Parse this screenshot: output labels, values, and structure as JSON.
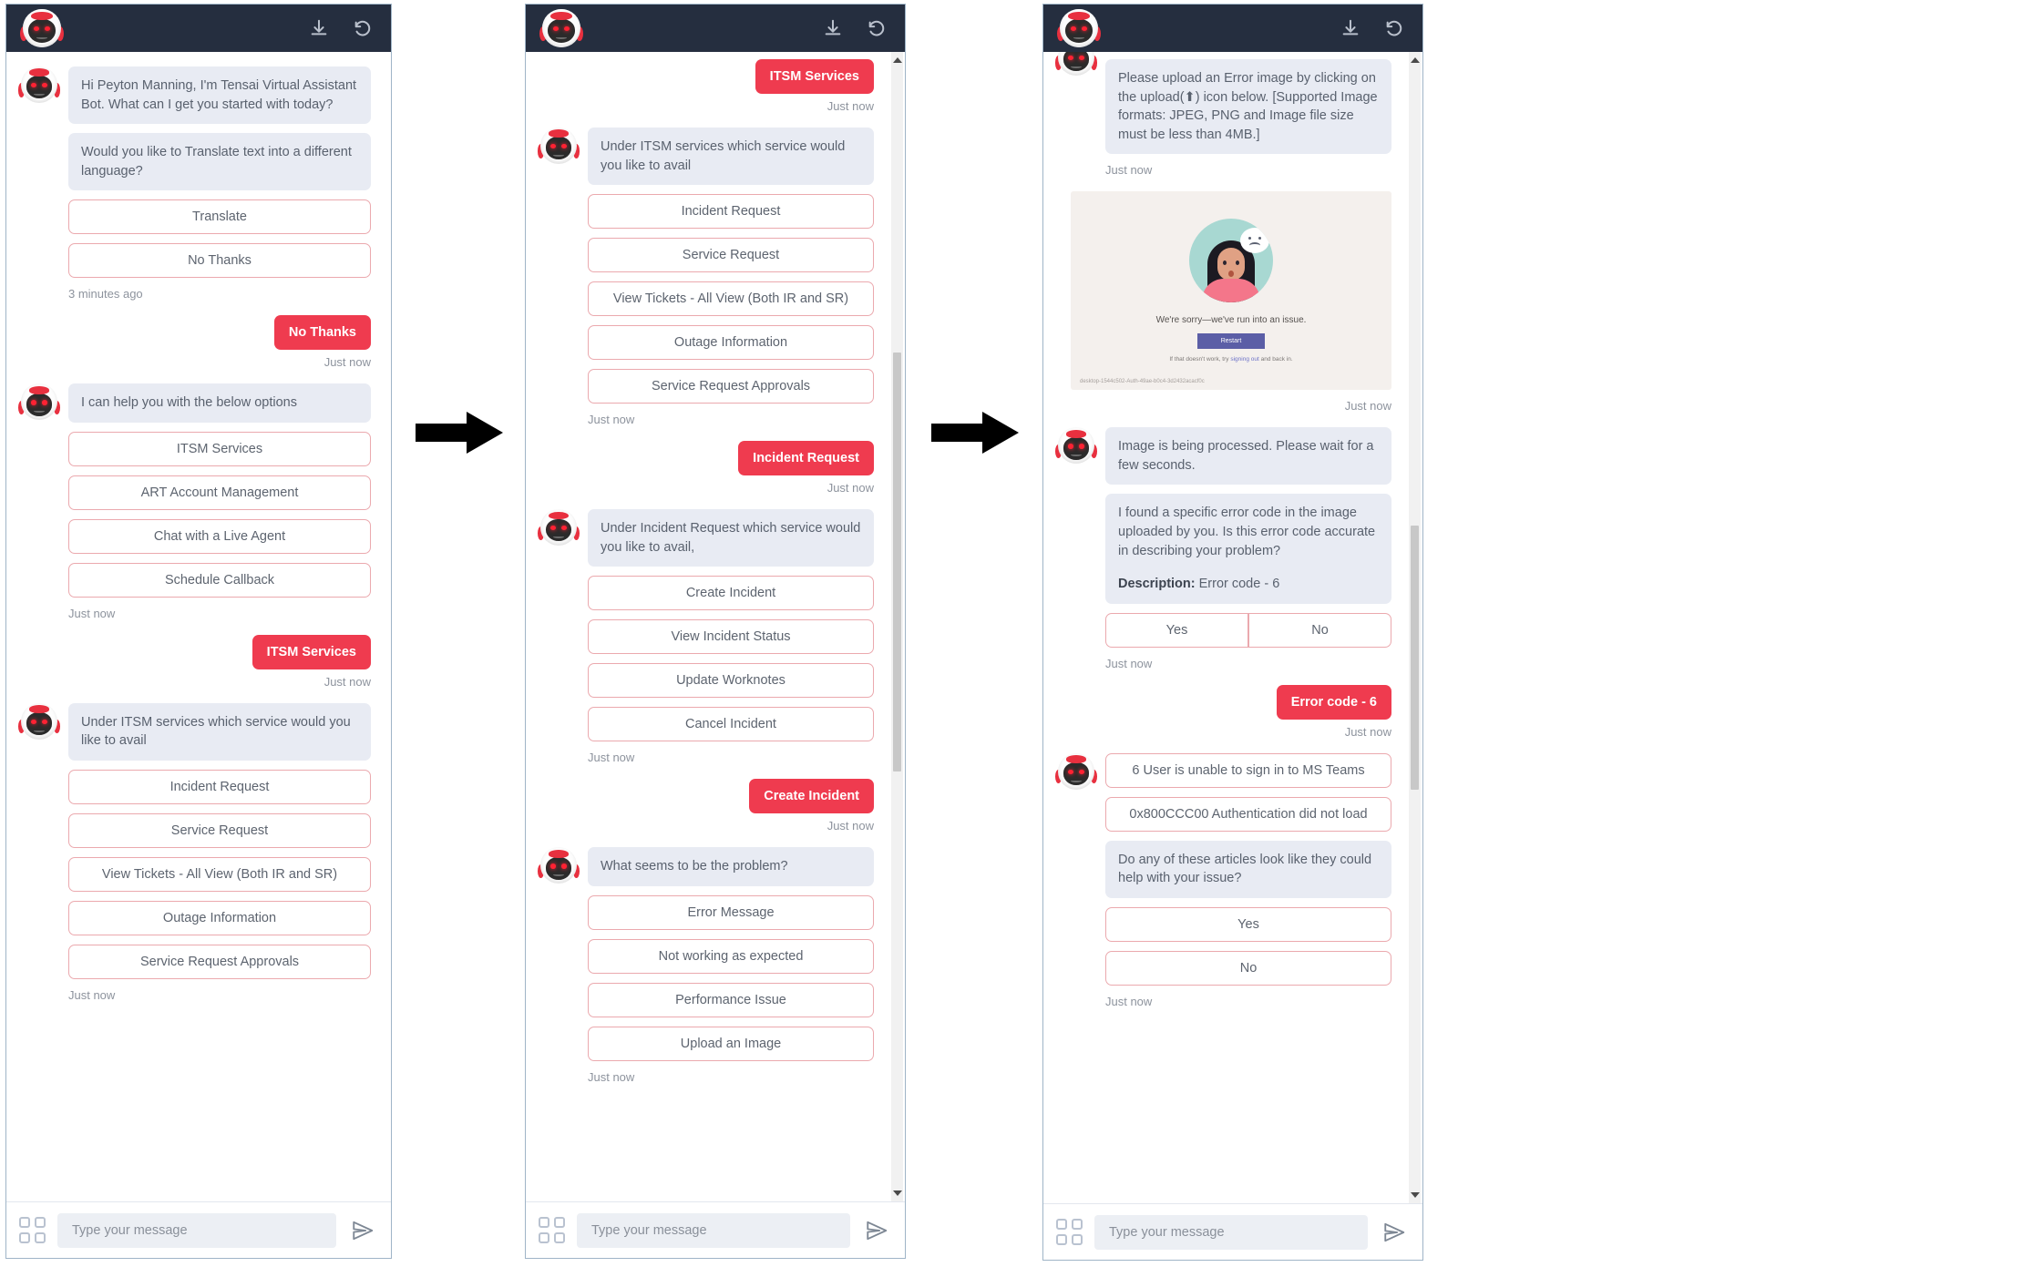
{
  "header": {
    "download_icon": "download-icon",
    "reset_icon": "reset-icon",
    "bot_icon": "bot-avatar-icon"
  },
  "input_bar": {
    "apps_icon": "grid-apps-icon",
    "placeholder": "Type your message",
    "value": "",
    "send_icon": "send-icon"
  },
  "colors": {
    "header_bg": "#252e3f",
    "user_bubble": "#ef3b4f",
    "bot_bubble": "#e8ebf3",
    "option_border": "#eba9ae",
    "panel_border": "#9fb4c7"
  },
  "panels": [
    {
      "id": "panel-1",
      "messages": [
        {
          "type": "bot_bubble",
          "text": "Hi Peyton Manning, I'm Tensai Virtual Assistant Bot. What can I get you started with today?"
        },
        {
          "type": "bot_bubble",
          "text": "Would you like to Translate text into a different language?"
        },
        {
          "type": "option",
          "text": "Translate"
        },
        {
          "type": "option",
          "text": "No Thanks"
        },
        {
          "type": "stamp",
          "text": "3 minutes ago"
        },
        {
          "type": "user_bubble",
          "text": "No Thanks"
        },
        {
          "type": "stamp_right",
          "text": "Just now"
        },
        {
          "type": "bot_bubble",
          "text": "I can help you with the below options"
        },
        {
          "type": "option",
          "text": "ITSM Services"
        },
        {
          "type": "option",
          "text": "ART Account Management"
        },
        {
          "type": "option",
          "text": "Chat with a Live Agent"
        },
        {
          "type": "option",
          "text": "Schedule Callback"
        },
        {
          "type": "stamp",
          "text": "Just now"
        },
        {
          "type": "user_bubble",
          "text": "ITSM Services"
        },
        {
          "type": "stamp_right",
          "text": "Just now"
        },
        {
          "type": "bot_bubble",
          "text": "Under ITSM services which service would you like to avail"
        },
        {
          "type": "option",
          "text": "Incident Request"
        },
        {
          "type": "option",
          "text": "Service Request"
        },
        {
          "type": "option",
          "text": "View Tickets - All View (Both IR and SR)"
        },
        {
          "type": "option",
          "text": "Outage Information"
        },
        {
          "type": "option",
          "text": "Service Request Approvals"
        },
        {
          "type": "stamp",
          "text": "Just now"
        }
      ]
    },
    {
      "id": "panel-2",
      "messages": [
        {
          "type": "user_bubble",
          "text": "ITSM Services"
        },
        {
          "type": "stamp_right",
          "text": "Just now"
        },
        {
          "type": "bot_bubble",
          "text": "Under ITSM services which service would you like to avail"
        },
        {
          "type": "option",
          "text": "Incident Request"
        },
        {
          "type": "option",
          "text": "Service Request"
        },
        {
          "type": "option",
          "text": "View Tickets - All View (Both IR and SR)"
        },
        {
          "type": "option",
          "text": "Outage Information"
        },
        {
          "type": "option",
          "text": "Service Request Approvals"
        },
        {
          "type": "stamp",
          "text": "Just now"
        },
        {
          "type": "user_bubble",
          "text": "Incident Request"
        },
        {
          "type": "stamp_right",
          "text": "Just now"
        },
        {
          "type": "bot_bubble",
          "text": "Under Incident Request which service would you like to avail,"
        },
        {
          "type": "option",
          "text": "Create Incident"
        },
        {
          "type": "option",
          "text": "View Incident Status"
        },
        {
          "type": "option",
          "text": "Update Worknotes"
        },
        {
          "type": "option",
          "text": "Cancel Incident"
        },
        {
          "type": "stamp",
          "text": "Just now"
        },
        {
          "type": "user_bubble",
          "text": "Create Incident"
        },
        {
          "type": "stamp_right",
          "text": "Just now"
        },
        {
          "type": "bot_bubble",
          "text": "What seems to be the problem?"
        },
        {
          "type": "option",
          "text": "Error Message"
        },
        {
          "type": "option",
          "text": "Not working as expected"
        },
        {
          "type": "option",
          "text": "Performance Issue"
        },
        {
          "type": "option",
          "text": "Upload an Image"
        },
        {
          "type": "stamp",
          "text": "Just now"
        }
      ]
    },
    {
      "id": "panel-3",
      "messages": [
        {
          "type": "bot_bubble",
          "text": "Please upload an Error image by clicking on the upload(⬆) icon below. [Supported Image formats: JPEG, PNG and Image file size must be less than 4MB.]"
        },
        {
          "type": "stamp",
          "text": "Just now"
        },
        {
          "type": "screenshot",
          "caption": "We're sorry—we've run into an issue.",
          "button": "Restart",
          "hint_prefix": "If that doesn't work, try ",
          "hint_link": "signing out",
          "hint_suffix": " and back in.",
          "footer": "desktop-1544c502-Auth-49ae-b0c4-3d2432acacf0c"
        },
        {
          "type": "stamp_right",
          "text": "Just now"
        },
        {
          "type": "bot_bubble",
          "text": "Image is being processed. Please wait for a few seconds."
        },
        {
          "type": "bot_bubble_rich",
          "text": "I found a specific error code in the image uploaded by you. Is this error code accurate in describing your problem?",
          "label": "Description:",
          "value": " Error code - 6"
        },
        {
          "type": "option_pair",
          "left": "Yes",
          "right": "No"
        },
        {
          "type": "stamp",
          "text": "Just now"
        },
        {
          "type": "user_bubble",
          "text": "Error code - 6"
        },
        {
          "type": "stamp_right",
          "text": "Just now"
        },
        {
          "type": "option",
          "text": "6 User is unable to sign in to MS Teams"
        },
        {
          "type": "option",
          "text": "0x800CCC00 Authentication did not load"
        },
        {
          "type": "bot_bubble",
          "text": "Do any of these articles look like they could help with your issue?"
        },
        {
          "type": "option",
          "text": "Yes"
        },
        {
          "type": "option",
          "text": "No"
        },
        {
          "type": "stamp",
          "text": "Just now"
        }
      ]
    }
  ]
}
